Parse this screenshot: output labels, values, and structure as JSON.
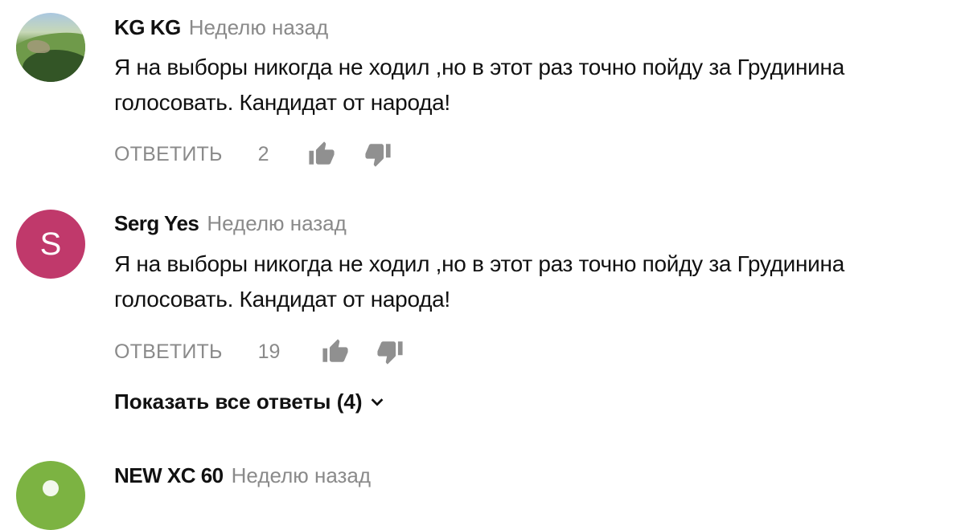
{
  "comments": [
    {
      "author": "KG KG",
      "time": "Неделю назад",
      "text_line1": "Я на выборы никогда не ходил ,но в этот раз точно пойду за Грудинина",
      "text_line2": "голосовать. Кандидат от народа!",
      "reply_label": "ОТВЕТИТЬ",
      "likes": "2",
      "avatar": {
        "type": "photo"
      }
    },
    {
      "author": "Serg Yes",
      "time": "Неделю назад",
      "text_line1": "Я на выборы никогда не ходил ,но в этот раз точно пойду за Грудинина",
      "text_line2": "голосовать. Кандидат от народа!",
      "reply_label": "ОТВЕТИТЬ",
      "likes": "19",
      "avatar": {
        "type": "letter",
        "letter": "S",
        "color": "#c0396b"
      },
      "show_replies_label": "Показать все ответы (4)"
    },
    {
      "author": "NEW XC 60",
      "time": "Неделю назад",
      "avatar": {
        "type": "default",
        "color": "#7cb342"
      }
    }
  ],
  "icons": {
    "like": "thumb-up-icon",
    "dislike": "thumb-down-icon",
    "expand": "chevron-down-icon"
  },
  "colors": {
    "secondary_text": "#8a8a8a",
    "primary_text": "#111111"
  }
}
